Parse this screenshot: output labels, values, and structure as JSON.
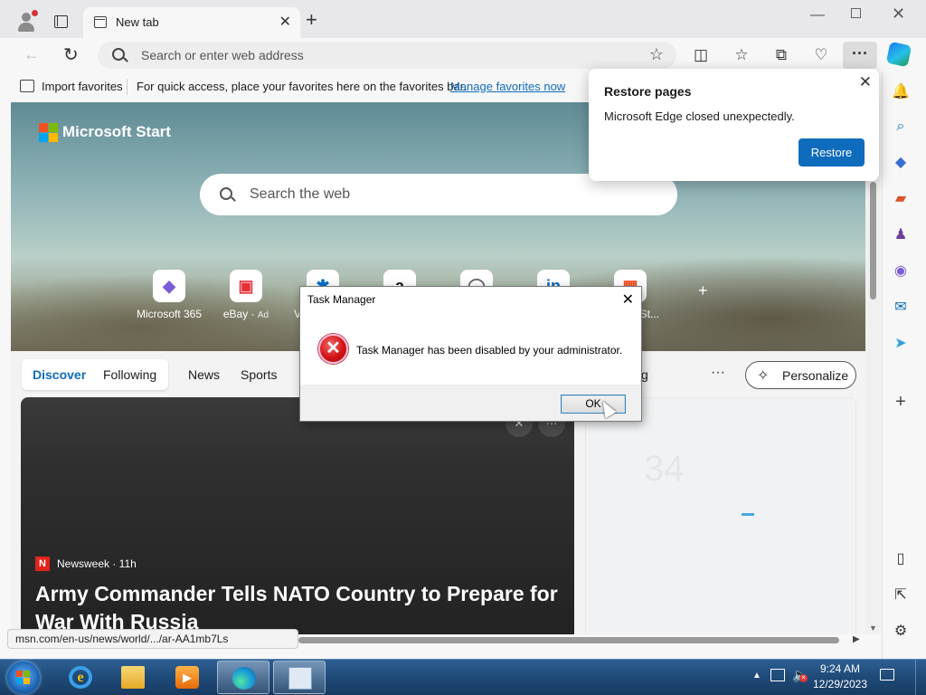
{
  "browser": {
    "tab_title": "New tab",
    "address_placeholder": "Search or enter web address",
    "window_controls": {
      "minimize": "—",
      "close": "✕"
    }
  },
  "favorites_bar": {
    "import_label": "Import favorites",
    "hint": "For quick access, place your favorites here on the favorites bar.",
    "manage_link": "Manage favorites now"
  },
  "restore_popup": {
    "title": "Restore pages",
    "message": "Microsoft Edge closed unexpectedly.",
    "button": "Restore"
  },
  "start_page": {
    "brand": "Microsoft Start",
    "search_placeholder": "Search the web",
    "quick_links": [
      {
        "label": "Microsoft 365",
        "ad": "",
        "glyph": "◆",
        "color": "#7b5cd6"
      },
      {
        "label": "eBay",
        "ad": "Ad",
        "glyph": "▣",
        "color": "#e53238"
      },
      {
        "label": "V",
        "ad": "",
        "glyph": "✱",
        "color": "#0071ce"
      },
      {
        "label": "",
        "ad": "",
        "glyph": "a",
        "color": "#111111"
      },
      {
        "label": "",
        "ad": "",
        "glyph": "◯",
        "color": "#666666"
      },
      {
        "label": "",
        "ad": "",
        "glyph": "in",
        "color": "#0a66c2"
      },
      {
        "label": "St...",
        "ad": "",
        "glyph": "▦",
        "color": "#f25022"
      }
    ],
    "feed_tabs": {
      "discover": "Discover",
      "following": "Following",
      "news": "News",
      "sports": "Sports",
      "partial": "g",
      "more": "···",
      "personalize": "Personalize"
    },
    "article": {
      "source": "Newsweek · 11h",
      "source_logo": "N",
      "headline": "Army Commander Tells NATO Country to Prepare for War With Russia"
    },
    "weather": {
      "temp": "34"
    }
  },
  "status_url": "msn.com/en-us/news/world/.../ar-AA1mb7Ls",
  "dialog": {
    "title": "Task Manager",
    "message": "Task Manager has been disabled by your administrator.",
    "ok": "OK"
  },
  "taskbar": {
    "time": "9:24 AM",
    "date": "12/29/2023",
    "apps": [
      "internet-explorer",
      "file-explorer",
      "media-player",
      "edge",
      "task-manager"
    ]
  },
  "colors": {
    "accent": "#0f6cbd",
    "taskbar": "#1f4a78",
    "error_icon": "#d31414"
  }
}
